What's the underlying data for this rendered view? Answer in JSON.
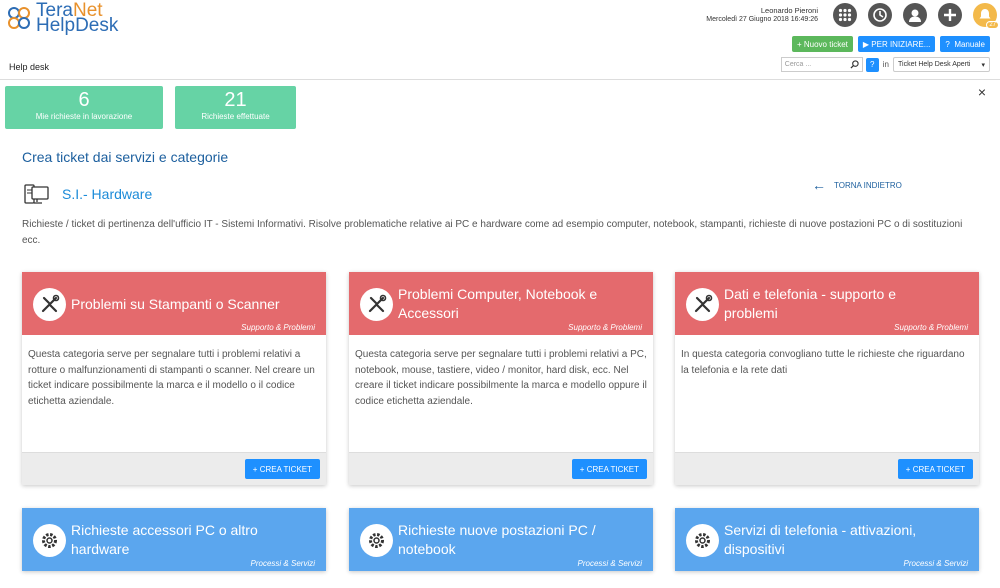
{
  "logo": {
    "line1_a": "Tera",
    "line1_b": "Net",
    "line2": "HelpDesk"
  },
  "user": {
    "name": "Leonardo Pieroni",
    "datetime": "Mercoledì 27 Giugno 2018 16:49:26"
  },
  "top_icons": [
    "apps-grid-icon",
    "history-icon",
    "user-profile-icon",
    "add-icon",
    "notifications-icon"
  ],
  "notifications_count": "27",
  "actions": {
    "new_ticket": "Nuovo ticket",
    "start": "PER INIZIARE...",
    "manual": "Manuale"
  },
  "breadcrumb": "Help desk",
  "search": {
    "placeholder": "Cerca ...",
    "help": "?",
    "in_label": "in",
    "scope": "Ticket Help Desk Aperti"
  },
  "stats": [
    {
      "value": "6",
      "label": "Mie richieste in lavorazione"
    },
    {
      "value": "21",
      "label": "Richieste effettuate"
    }
  ],
  "close": "×",
  "section_title": "Crea ticket dai servizi e categorie",
  "category": {
    "name": "S.I.- Hardware",
    "description": "Richieste / ticket di pertinenza dell'ufficio IT - Sistemi Informativi. Risolve problematiche relative ai PC e hardware come ad esempio computer, notebook, stampanti, richieste di nuove postazioni PC o di sostituzioni ecc."
  },
  "back_link": "TORNA INDIETRO",
  "crea_label": "CREA TICKET",
  "cards": [
    {
      "title": "Problemi su Stampanti o Scanner",
      "subtitle": "Supporto & Problemi",
      "body": "Questa categoria serve per segnalare tutti i problemi relativi a rotture o malfunzionamenti di stampanti o scanner. Nel creare un ticket indicare possibilmente la marca e il modello o il codice etichetta aziendale."
    },
    {
      "title": "Problemi Computer, Notebook e Accessori",
      "subtitle": "Supporto & Problemi",
      "body": "Questa categoria serve per segnalare tutti i problemi relativi a PC, notebook, mouse, tastiere, video / monitor, hard disk, ecc. Nel creare il ticket indicare possibilmente la marca e modello oppure il codice etichetta aziendale."
    },
    {
      "title": "Dati e telefonia - supporto e problemi",
      "subtitle": "Supporto & Problemi",
      "body": "In questa categoria convogliano tutte le richieste che riguardano la telefonia e la rete dati"
    },
    {
      "title": "Richieste accessori PC o altro hardware",
      "subtitle": "Processi & Servizi",
      "body": ""
    },
    {
      "title": "Richieste nuove postazioni PC / notebook",
      "subtitle": "Processi & Servizi",
      "body": ""
    },
    {
      "title": "Servizi di telefonia - attivazioni, dispositivi",
      "subtitle": "Processi & Servizi",
      "body": ""
    }
  ],
  "colors": {
    "support": "#e46a6d",
    "process": "#5ba6ee",
    "stat": "#66d3a5",
    "primary": "#1e90ff",
    "green": "#5cb85c"
  }
}
